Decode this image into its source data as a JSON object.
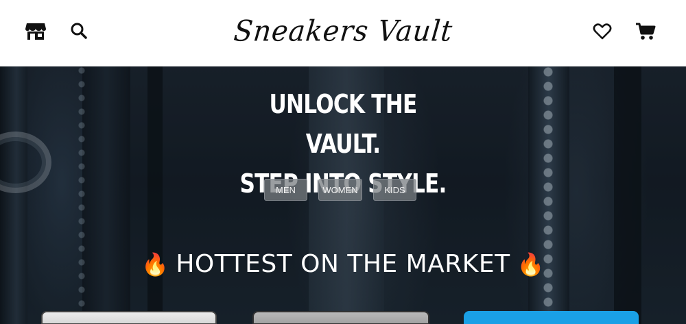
{
  "header": {
    "brand": "Sneakers Vault",
    "left_icons": [
      "store-icon",
      "search-icon"
    ],
    "right_icons": [
      "heart-icon",
      "cart-icon"
    ]
  },
  "hero": {
    "headline_line1": "UNLOCK THE VAULT.",
    "headline_line2": "STEP INTO STYLE.",
    "categories": [
      "MEN",
      "WOMEN",
      "KIDS"
    ]
  },
  "hottest": {
    "title": "HOTTEST ON THE MARKET",
    "flame_icon": "🔥"
  },
  "colors": {
    "header_bg": "#ffffff",
    "hero_bg": "#1b2530",
    "card3_accent": "#1aa0e6"
  }
}
